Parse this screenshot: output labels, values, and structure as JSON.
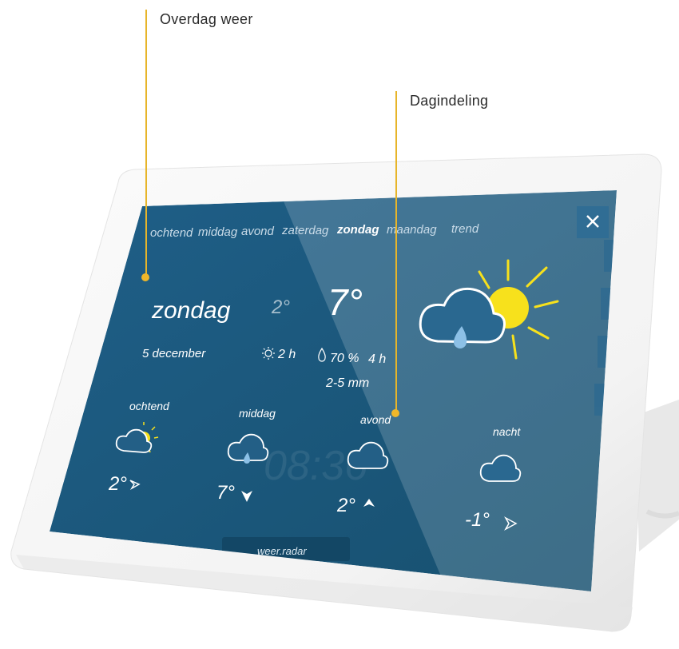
{
  "callouts": {
    "overdag": "Overdag weer",
    "dagindeling": "Dagindeling"
  },
  "tabs": [
    "ochtend",
    "middag",
    "avond",
    "zaterdag",
    "zondag",
    "maandag",
    "trend"
  ],
  "active_tab": "zondag",
  "day": {
    "name": "zondag",
    "date": "5 december",
    "temp_min": "2°",
    "temp_max": "7°",
    "sun": "2 h",
    "rain": "70 %",
    "rain_hours": "4 h",
    "rain_amount": "2-5 mm",
    "icon": "cloud-sun-rain-icon"
  },
  "parts": [
    {
      "label": "ochtend",
      "temp": "2°",
      "icon": "cloud-sun-icon",
      "wind": "wind-arrow-icon"
    },
    {
      "label": "middag",
      "temp": "7°",
      "icon": "cloud-rain-icon",
      "wind": "wind-arrow-icon"
    },
    {
      "label": "avond",
      "temp": "2°",
      "icon": "cloud-moon-icon",
      "wind": "wind-arrow-icon"
    },
    {
      "label": "nacht",
      "temp": "-1°",
      "icon": "cloud-moon-icon",
      "wind": "wind-arrow-icon"
    }
  ],
  "background": {
    "clock": "08:36",
    "footer": "weer.radar"
  },
  "colors": {
    "panel": "#1c5f8a",
    "accent_yellow": "#f7e11c",
    "callout_line": "#e7b52a",
    "rain_drop": "#8cc0e6"
  }
}
